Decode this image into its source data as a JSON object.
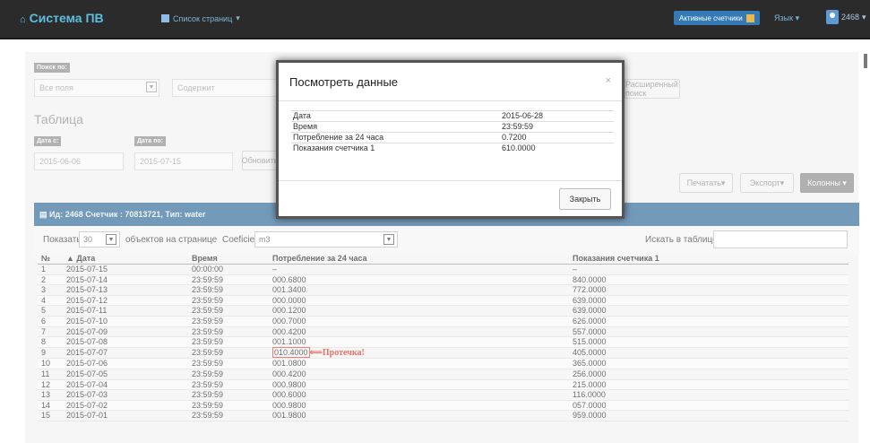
{
  "navbar": {
    "brand": "Система ПВ",
    "home_icon": "⌂",
    "pages_menu": "Список страниц",
    "active_counters": "Активные счетчики",
    "language": "Язык",
    "user_id": "2468"
  },
  "filters": {
    "search_label": "Поиск по:",
    "search_field": "Все поля",
    "contains": "Содержит",
    "advanced_search": "Расширенный поиск",
    "table_heading": "Таблица",
    "date_from_label": "Дата с:",
    "date_from": "2015-06-06",
    "date_to_label": "Дата по:",
    "date_to": "2015-07-15",
    "refresh": "Обновить",
    "print": "Печатать",
    "export": "Экспорт",
    "columns": "Колонны"
  },
  "panel": {
    "title": "Ид: 2468 Счетчик : 70813721, Тип: water"
  },
  "toolbar": {
    "show": "Показать",
    "per_page": "30",
    "objects_per_page": "объектов на странице",
    "coef_label": "Coeficient",
    "coef_value": "m3",
    "search_table": "Искать в таблице"
  },
  "table": {
    "headers": [
      "№",
      "Дата",
      "Время",
      "Потребление за 24 часа",
      "Показания счетчика 1"
    ],
    "rows": [
      [
        "1",
        "2015-07-15",
        "00:00:00",
        "–",
        "–"
      ],
      [
        "2",
        "2015-07-14",
        "23:59:59",
        "000.6800",
        "840.0000"
      ],
      [
        "3",
        "2015-07-13",
        "23:59:59",
        "001.3400",
        "772.0000"
      ],
      [
        "4",
        "2015-07-12",
        "23:59:59",
        "000.0000",
        "639.0000"
      ],
      [
        "5",
        "2015-07-11",
        "23:59:59",
        "000.1200",
        "639.0000"
      ],
      [
        "6",
        "2015-07-10",
        "23:59:59",
        "000.7000",
        "626.0000"
      ],
      [
        "7",
        "2015-07-09",
        "23:59:59",
        "000.4200",
        "557.0000"
      ],
      [
        "8",
        "2015-07-08",
        "23:59:59",
        "001.1000",
        "515.0000"
      ],
      [
        "9",
        "2015-07-07",
        "23:59:59",
        "010.4000",
        "405.0000"
      ],
      [
        "10",
        "2015-07-06",
        "23:59:59",
        "001.0800",
        "365.0000"
      ],
      [
        "11",
        "2015-07-05",
        "23:59:59",
        "000.4200",
        "256.0000"
      ],
      [
        "12",
        "2015-07-04",
        "23:59:59",
        "000.9800",
        "215.0000"
      ],
      [
        "13",
        "2015-07-03",
        "23:59:59",
        "000.6000",
        "116.0000"
      ],
      [
        "14",
        "2015-07-02",
        "23:59:59",
        "000.9800",
        "057.0000"
      ],
      [
        "15",
        "2015-07-01",
        "23:59:59",
        "001.9800",
        "959.0000"
      ]
    ],
    "leak_row_index": 8,
    "leak_note": "⟸Протечка!"
  },
  "modal": {
    "title": "Посмотреть данные",
    "close_x": "×",
    "rows": [
      [
        "Дата",
        "2015-06-28"
      ],
      [
        "Время",
        "23:59:59"
      ],
      [
        "Потребление за 24 часа",
        "0.7200"
      ],
      [
        "Показания счетчика 1",
        "610.0000"
      ]
    ],
    "close_button": "Закрыть"
  }
}
